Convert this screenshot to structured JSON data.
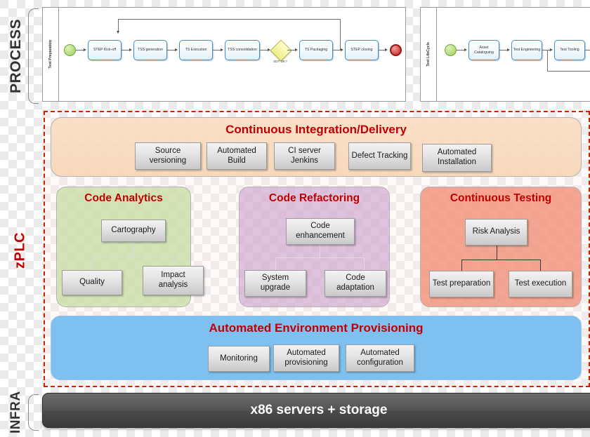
{
  "bands": {
    "process_label": "PROCESS",
    "zplc_label": "zPLC",
    "infra_label": "INFRA"
  },
  "process": {
    "left_panel": {
      "lane_title": "Test Preparation",
      "start_event": "start-event",
      "tasks": [
        "STEP Kick-off",
        "TSS generation",
        "TS Execution",
        "TSS consolidation",
        "TS Packaging",
        "STEP closing"
      ],
      "gateway_label": "SDT OK?",
      "end_event": "end-event"
    },
    "right_panel": {
      "lane_title": "Test LifeCycle",
      "start_event": "start-event",
      "tasks": [
        "Asset Cataloguing",
        "Test Engineering",
        "Test Tooling"
      ]
    }
  },
  "zplc": {
    "ci": {
      "title": "Continuous Integration/Delivery",
      "items": [
        "Source versioning",
        "Automated Build",
        "CI server Jenkins",
        "Defect Tracking",
        "Automated Installation"
      ]
    },
    "code_analytics": {
      "title": "Code Analytics",
      "root": "Cartography",
      "children": [
        "Quality",
        "Impact analysis"
      ]
    },
    "code_refactoring": {
      "title": "Code Refactoring",
      "root": "Code enhancement",
      "children": [
        "System upgrade",
        "Code adaptation"
      ]
    },
    "continuous_testing": {
      "title": "Continuous Testing",
      "root": "Risk Analysis",
      "children": [
        "Test preparation",
        "Test execution"
      ]
    },
    "env_provisioning": {
      "title": "Automated Environment Provisioning",
      "items": [
        "Monitoring",
        "Automated provisioning",
        "Automated configuration"
      ]
    }
  },
  "infra": {
    "bar_label": "x86 servers + storage"
  },
  "colors": {
    "accent_red": "#c00000",
    "dashed_border": "#cc2200",
    "ci_panel": "#fadec4",
    "analytics_panel": "#cbdfa6",
    "refactoring_panel": "#cfa6cf",
    "testing_panel": "#f28e74",
    "provisioning_panel": "#7ec0f0",
    "infra_bar": "#4a4a4a"
  }
}
